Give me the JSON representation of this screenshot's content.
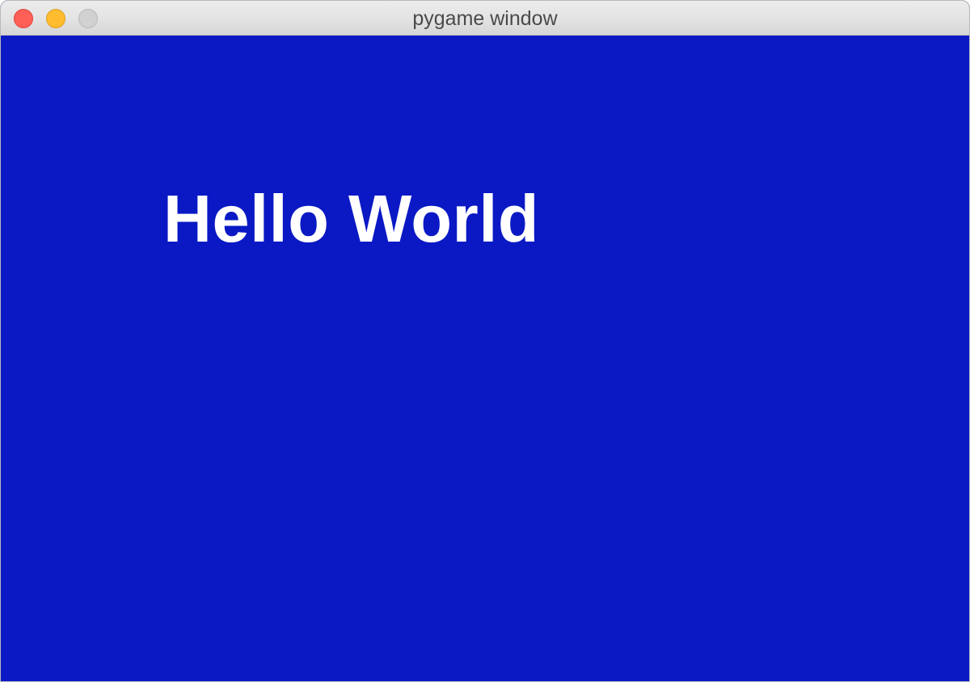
{
  "window": {
    "title": "pygame window",
    "buttons": [
      {
        "name": "close",
        "color": "#fe5f57"
      },
      {
        "name": "minimize",
        "color": "#febc2e"
      },
      {
        "name": "zoom",
        "color": "#d1d1d1"
      }
    ]
  },
  "canvas": {
    "background_color": "#0a19c4",
    "text": "Hello World",
    "text_color": "#ffffff"
  }
}
